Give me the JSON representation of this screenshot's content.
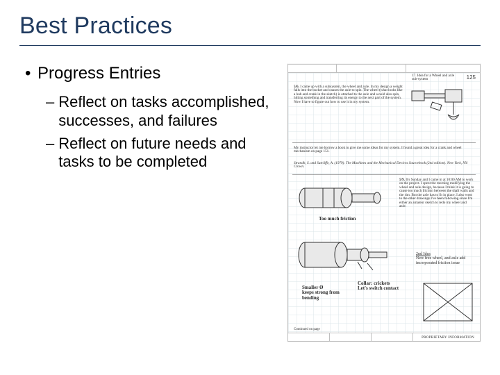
{
  "title": "Best Practices",
  "bullet1": "Progress Entries",
  "sub1": "Reflect on tasks accomplished, successes, and failures",
  "sub2": "Reflect on future needs and tasks to be completed",
  "notebook": {
    "page_number": "125",
    "header_title": "17. Idea for a Wheel and axle sub-system",
    "entry_date": "5/6.",
    "entry_body": "I came up with a subsystem, the wheel and axle. In my design a weight falls into the bucket and causes the axle to spin. The wheel (what looks like a hub and crank in the sketch) is attached to the axle and would also spin, hitting something and transferring its energy to the next part of the system. Now I have to figure out how to use it in my system.",
    "note_middle": "My instructor let me borrow a book to give me some ideas for my system. I found a great idea for a crank and wheel mechanism on page 151.",
    "citation": "Strandh, S. and Sutcliffe, A. (1979). The Machines and the Mechanical Devices Sourcebook (2nd edition). New York, NY: Crown.",
    "entry2_date": "5/9.",
    "entry2_body": "It's Sunday and I came in at 10:00 AM to work on the project. I spent the morning modifying the wheel and axle design, because I think it is going to cause too much friction between the shaft walls and the rim. But the axle has to fit in place. I also went to the other drawings I've been following since I'm either an amateur sketch to redo my wheel and axle.",
    "label_top": "Too much friction",
    "idea_heading": "2nd Idea",
    "idea_body": "New free wheel, and axle add incorporated friction issue",
    "label_smaller": "Smaller Ø",
    "label_keeps": "keeps strong from bending",
    "label_collar": "Collar: crickets",
    "label_switch": "Let's switch contact",
    "footer_label": "PROPRIETARY INFORMATION",
    "footer_continued": "Continued on page"
  }
}
